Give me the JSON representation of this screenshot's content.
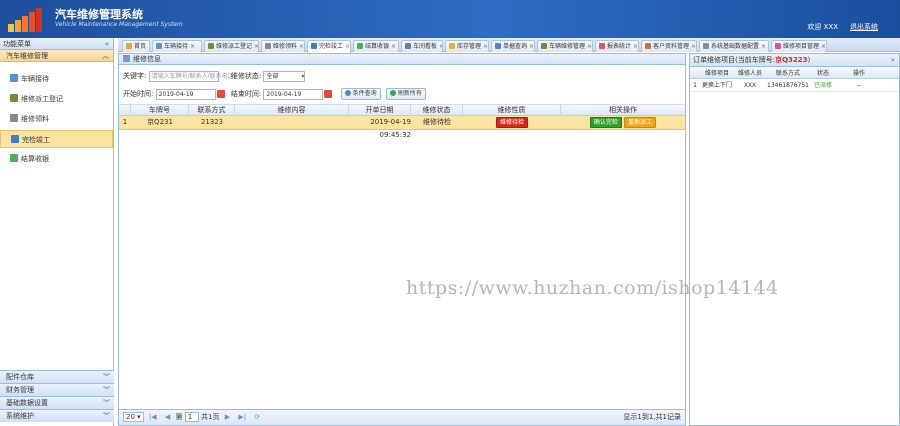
{
  "header": {
    "title": "汽车维修管理系统",
    "subtitle": "Vehicle Maintenance Management System",
    "user": "欢迎 XXX",
    "exit": "退出系统"
  },
  "sidebar": {
    "menu_title": "功能菜单",
    "group": "汽车维修管理",
    "items": [
      {
        "label": "车辆接待"
      },
      {
        "label": "维修派工登记"
      },
      {
        "label": "维修领料"
      },
      {
        "label": "完检竣工"
      },
      {
        "label": "结算收银"
      }
    ],
    "bottom_groups": [
      {
        "label": "配件仓库"
      },
      {
        "label": "财务管理"
      },
      {
        "label": "基础数据设置"
      },
      {
        "label": "系统维护"
      }
    ]
  },
  "tabs": [
    {
      "label": "首页"
    },
    {
      "label": "车辆接待"
    },
    {
      "label": "维修派工登记"
    },
    {
      "label": "维修领料"
    },
    {
      "label": "完检竣工"
    },
    {
      "label": "结算收银"
    },
    {
      "label": "车间看板"
    },
    {
      "label": "库存管理"
    },
    {
      "label": "单据查询"
    },
    {
      "label": "车辆维修管理"
    },
    {
      "label": "报表统计"
    },
    {
      "label": "客户资料管理"
    },
    {
      "label": "系统基础数据配置"
    },
    {
      "label": "维修项目管理"
    }
  ],
  "main": {
    "panel_title": "维修信息",
    "keyword_label": "关键字:",
    "keyword_placeholder": "请输入车牌号/联系人/联系电话",
    "status_label": "维修状态:",
    "status_value": "全部",
    "start_label": "开始时间:",
    "start_value": "2019-04-19",
    "end_label": "结束时间:",
    "end_value": "2019-04-19",
    "search_button": "条件查询",
    "refresh_button": "刷新所有",
    "columns": [
      "车牌号",
      "联系方式",
      "维修内容",
      "开单日期",
      "维修状态",
      "维修性质",
      "相关操作"
    ],
    "rows": [
      {
        "num": "1",
        "plate": "京Q231",
        "contact": "21323",
        "content": "",
        "date": "2019-04-19 09:45:32",
        "status": "维修待检",
        "nature": "维修待检",
        "action1": "确认完检",
        "action2": "重新派工"
      }
    ],
    "pager": {
      "page_size": "20",
      "page_label_pre": "第",
      "page_value": "1",
      "page_label_post": "共1页",
      "info": "显示1到1,共1记录"
    }
  },
  "right": {
    "title_pre": "订单维修项目(当前车牌号:",
    "title_plate": "京Q3223",
    "title_post": ")",
    "columns": [
      "维修项目",
      "维修人员",
      "联系方式",
      "状态",
      "操作"
    ],
    "rows": [
      {
        "num": "1",
        "item": "更换上下门",
        "worker": "XXX",
        "phone": "13461876751",
        "status": "已派修",
        "op": "--"
      }
    ]
  },
  "watermark": "https://www.huzhan.com/ishop14144",
  "colors": {
    "header_blue": "#2d6cc2",
    "selected_row": "#fbe3a0",
    "danger": "#d8281e",
    "success": "#2e9e2e",
    "warning": "#f0a31b"
  }
}
